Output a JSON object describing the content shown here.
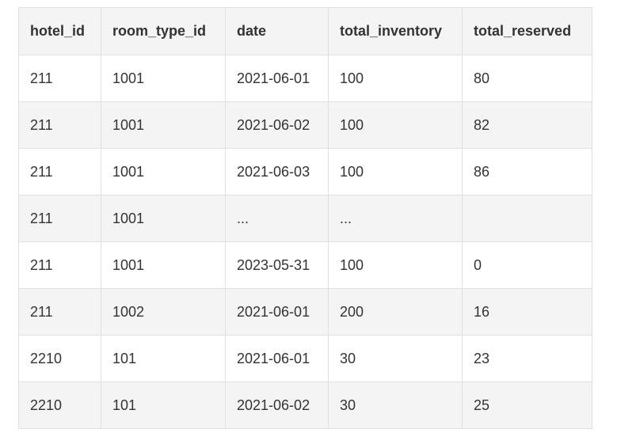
{
  "table": {
    "columns": [
      "hotel_id",
      "room_type_id",
      "date",
      "total_inventory",
      "total_reserved"
    ],
    "rows": [
      [
        "211",
        "1001",
        "2021-06-01",
        "100",
        "80"
      ],
      [
        "211",
        "1001",
        "2021-06-02",
        "100",
        "82"
      ],
      [
        "211",
        "1001",
        "2021-06-03",
        "100",
        "86"
      ],
      [
        "211",
        "1001",
        "...",
        "...",
        ""
      ],
      [
        "211",
        "1001",
        "2023-05-31",
        "100",
        "0"
      ],
      [
        "211",
        "1002",
        "2021-06-01",
        "200",
        "16"
      ],
      [
        "2210",
        "101",
        "2021-06-01",
        "30",
        "23"
      ],
      [
        "2210",
        "101",
        "2021-06-02",
        "30",
        "25"
      ]
    ]
  },
  "colors": {
    "header_bg": "#f4f4f4",
    "row_alt_bg": "#f4f4f4",
    "row_bg": "#ffffff",
    "border": "#e0e0e0",
    "text": "#333333"
  }
}
